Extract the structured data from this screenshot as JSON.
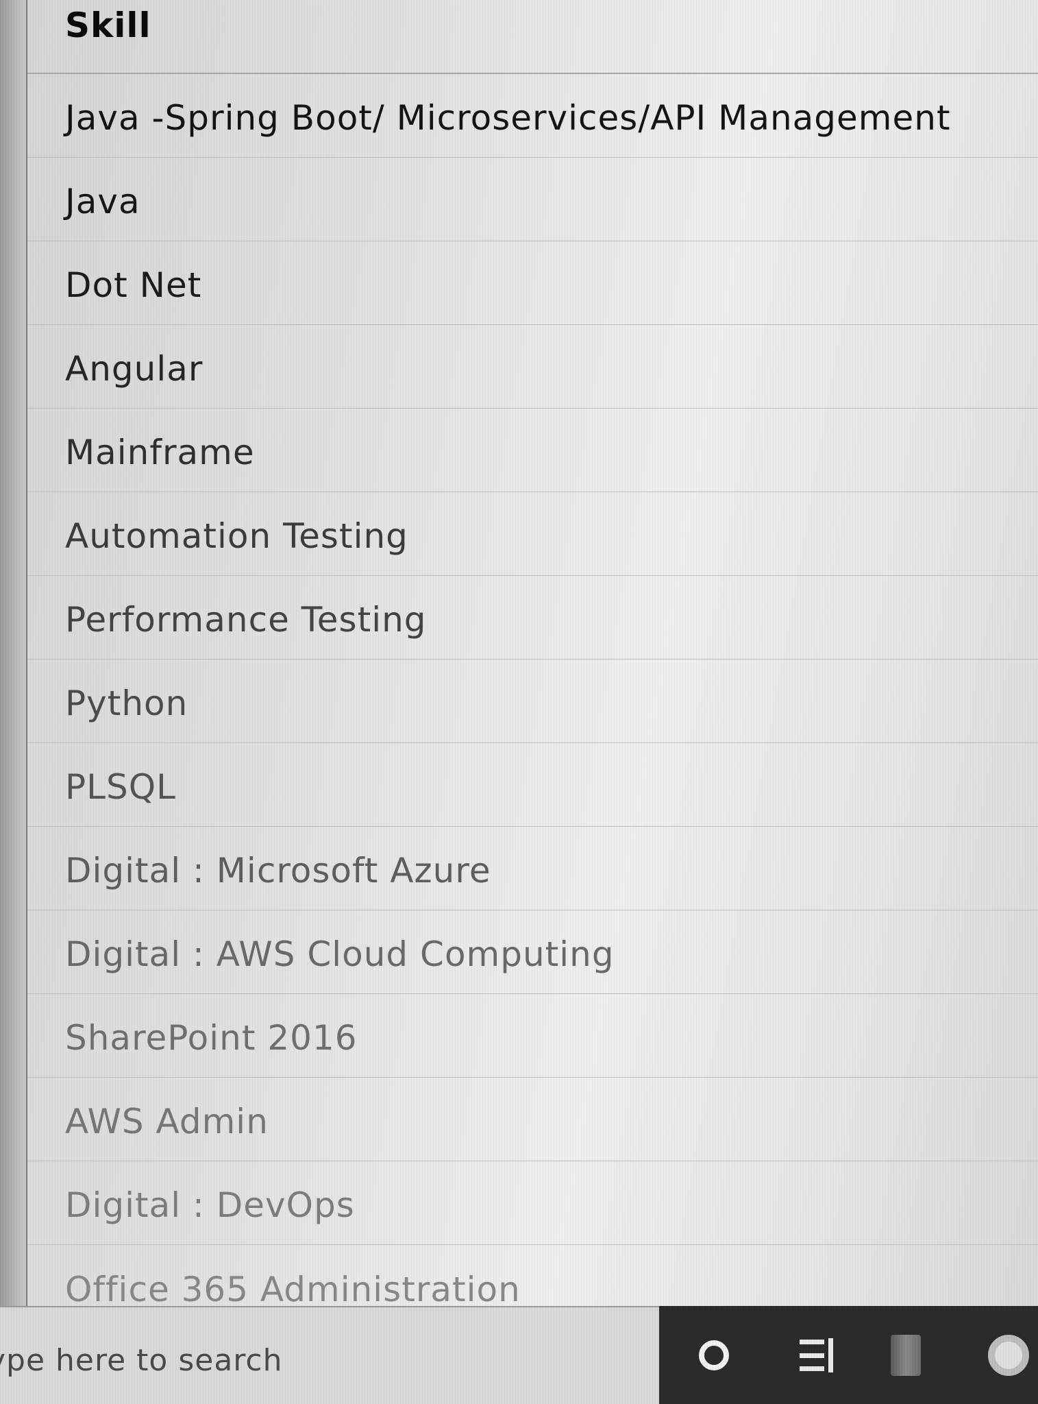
{
  "table": {
    "header": "Skill",
    "rows": [
      "Java -Spring Boot/ Microservices/API Management",
      "Java",
      "Dot Net",
      "Angular",
      "Mainframe",
      "Automation Testing",
      "Performance Testing",
      "Python",
      "PLSQL",
      "Digital : Microsoft Azure",
      "Digital : AWS Cloud Computing",
      "SharePoint 2016",
      "AWS Admin",
      "Digital : DevOps",
      "Office 365 Administration"
    ]
  },
  "taskbar": {
    "search_placeholder": "ype here to search",
    "icons": [
      "cortana-icon",
      "task-view-icon",
      "app-icon",
      "browser-icon"
    ],
    "background": "#2b2b2b"
  }
}
